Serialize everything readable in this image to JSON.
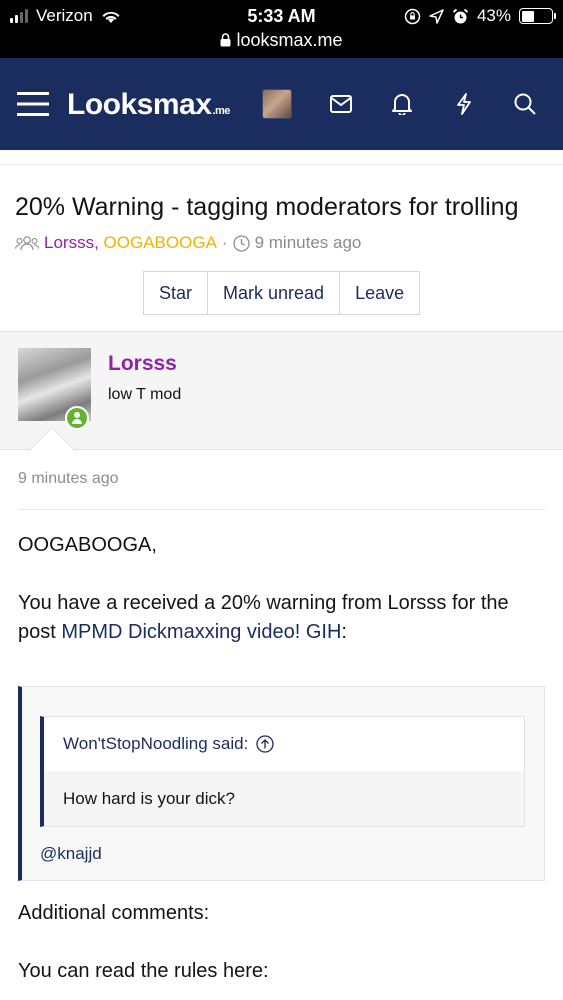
{
  "status_bar": {
    "carrier": "Verizon",
    "time": "5:33 AM",
    "url": "looksmax.me",
    "battery": "43%",
    "battery_level": 0.43,
    "icons": [
      "signal-icon",
      "wifi-icon",
      "lock-icon",
      "orientation-lock-icon",
      "location-icon",
      "alarm-icon",
      "battery-icon"
    ]
  },
  "nav": {
    "logo_main": "Looksmax",
    "logo_suffix": ".me",
    "icons": [
      "menu-icon",
      "avatar",
      "mail-icon",
      "bell-icon",
      "bolt-icon",
      "search-icon"
    ]
  },
  "thread": {
    "title": "20% Warning - tagging moderators for trolling",
    "participants": [
      "Lorsss",
      "OOGABOOGA"
    ],
    "participant_comma": ",",
    "meta_dot": "·",
    "time": "9 minutes ago",
    "buttons": [
      "Star",
      "Mark unread",
      "Leave"
    ]
  },
  "post": {
    "author": "Lorsss",
    "author_title": "low T mod",
    "date": "9 minutes ago",
    "greeting": "OOGABOOGA,",
    "body_prefix": "You have a received a 20% warning from Lorsss for the post ",
    "body_link": "MPMD Dickmaxxing video! GIH",
    "body_suffix": ":",
    "quote": {
      "author": "Won'tStopNoodling said:",
      "text": "How hard is your dick?",
      "mention": "@knajjd"
    },
    "additional": "Additional comments:",
    "rules": "You can read the rules here:"
  },
  "colors": {
    "navbar": "#1b2d5e",
    "username_purple": "#8e24aa",
    "username_yellow": "#f2b200",
    "online": "#63b32e"
  }
}
